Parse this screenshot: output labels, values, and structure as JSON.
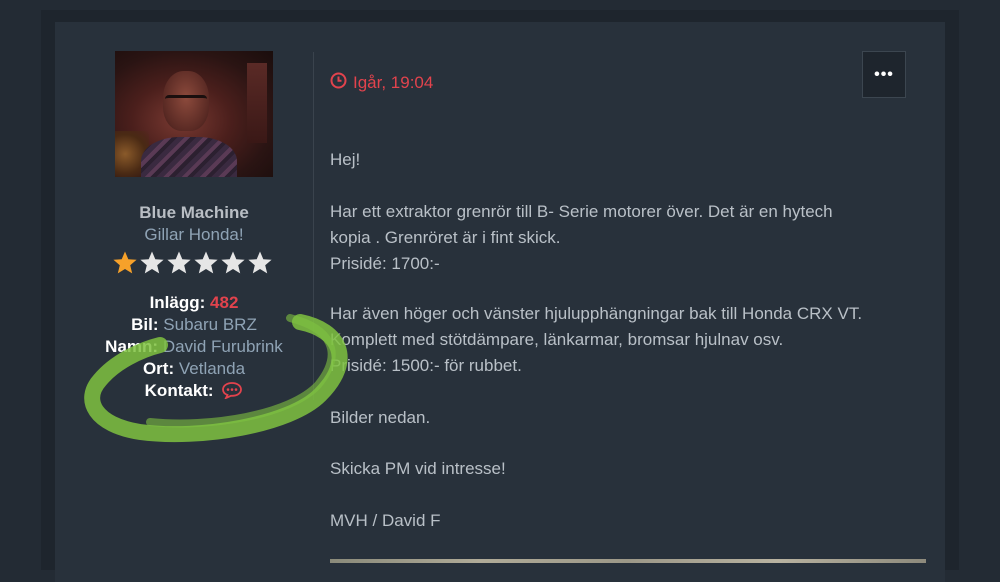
{
  "author": {
    "name": "Blue Machine",
    "title": "Gillar Honda!",
    "rating": {
      "filled": 1,
      "total": 6
    },
    "info": [
      {
        "label": "Inlägg:",
        "value": "482",
        "value_style": "red"
      },
      {
        "label": "Bil:",
        "value": "Subaru BRZ",
        "value_style": "link"
      },
      {
        "label": "Namn:",
        "value": "David Furubrink",
        "value_style": "link"
      },
      {
        "label": "Ort:",
        "value": "Vetlanda",
        "value_style": "link"
      },
      {
        "label": "Kontakt:",
        "value": "",
        "icon": "chat-bubble-icon"
      }
    ]
  },
  "post": {
    "timestamp": "Igår, 19:04",
    "timestamp_icon": "clock-icon",
    "menu_icon": "ellipsis-icon",
    "menu_label": "•••",
    "paragraphs": [
      [
        "Hej!"
      ],
      [
        "Har ett extraktor grenrör till B- Serie motorer över. Det är en hytech",
        "kopia . Grenröret är i fint skick.",
        "Prisidé: 1700:-"
      ],
      [
        "Har även höger och vänster hjulupphängningar bak till Honda CRX VT.",
        "Komplett med stötdämpare, länkarmar, bromsar hjulnav osv.",
        "Prisidé: 1500:- för rubbet."
      ],
      [
        "Bilder nedan."
      ],
      [
        "Skicka PM vid intresse!"
      ],
      [
        "MVH / David F"
      ]
    ]
  },
  "colors": {
    "background": "#232b34",
    "panel": "#28313b",
    "accent_red": "#e2434d",
    "link_blue": "#8fa3b5",
    "text": "#b9c0c7",
    "star_filled": "#f6a12a",
    "star_empty": "#e6e6e6",
    "highlight_green": "#7fc241"
  }
}
